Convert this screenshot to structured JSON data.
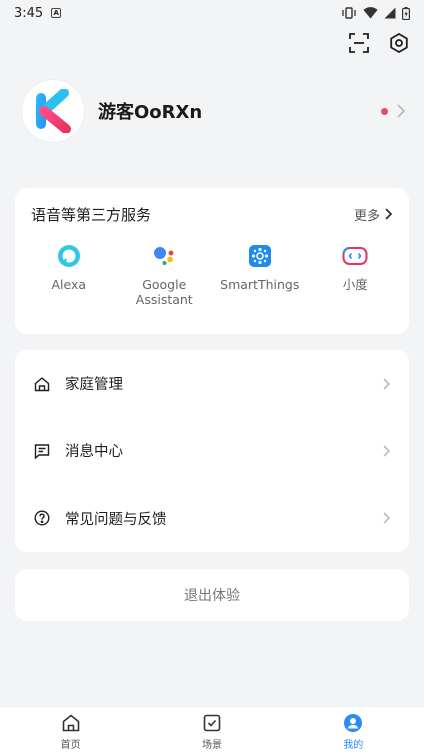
{
  "status_bar": {
    "time": "3:45",
    "notification_letter": "A"
  },
  "profile": {
    "username": "游客OoRXn"
  },
  "services": {
    "title": "语音等第三方服务",
    "more_label": "更多",
    "items": [
      {
        "label": "Alexa",
        "icon": "alexa-icon"
      },
      {
        "label": "Google\nAssistant",
        "icon": "google-assistant-icon"
      },
      {
        "label": "SmartThings",
        "icon": "smartthings-icon"
      },
      {
        "label": "小度",
        "icon": "xiaodu-icon"
      }
    ]
  },
  "menu": {
    "items": [
      {
        "label": "家庭管理",
        "icon": "home-icon"
      },
      {
        "label": "消息中心",
        "icon": "message-icon"
      },
      {
        "label": "常见问题与反馈",
        "icon": "help-icon"
      }
    ]
  },
  "logout": {
    "label": "退出体验"
  },
  "tabbar": {
    "items": [
      {
        "label": "首页",
        "icon": "home-tab-icon"
      },
      {
        "label": "场景",
        "icon": "scene-tab-icon"
      },
      {
        "label": "我的",
        "icon": "profile-tab-icon",
        "active": true
      }
    ]
  },
  "colors": {
    "accent": "#2a8cf7",
    "badge": "#e84a5f",
    "background": "#f3f4f6"
  }
}
